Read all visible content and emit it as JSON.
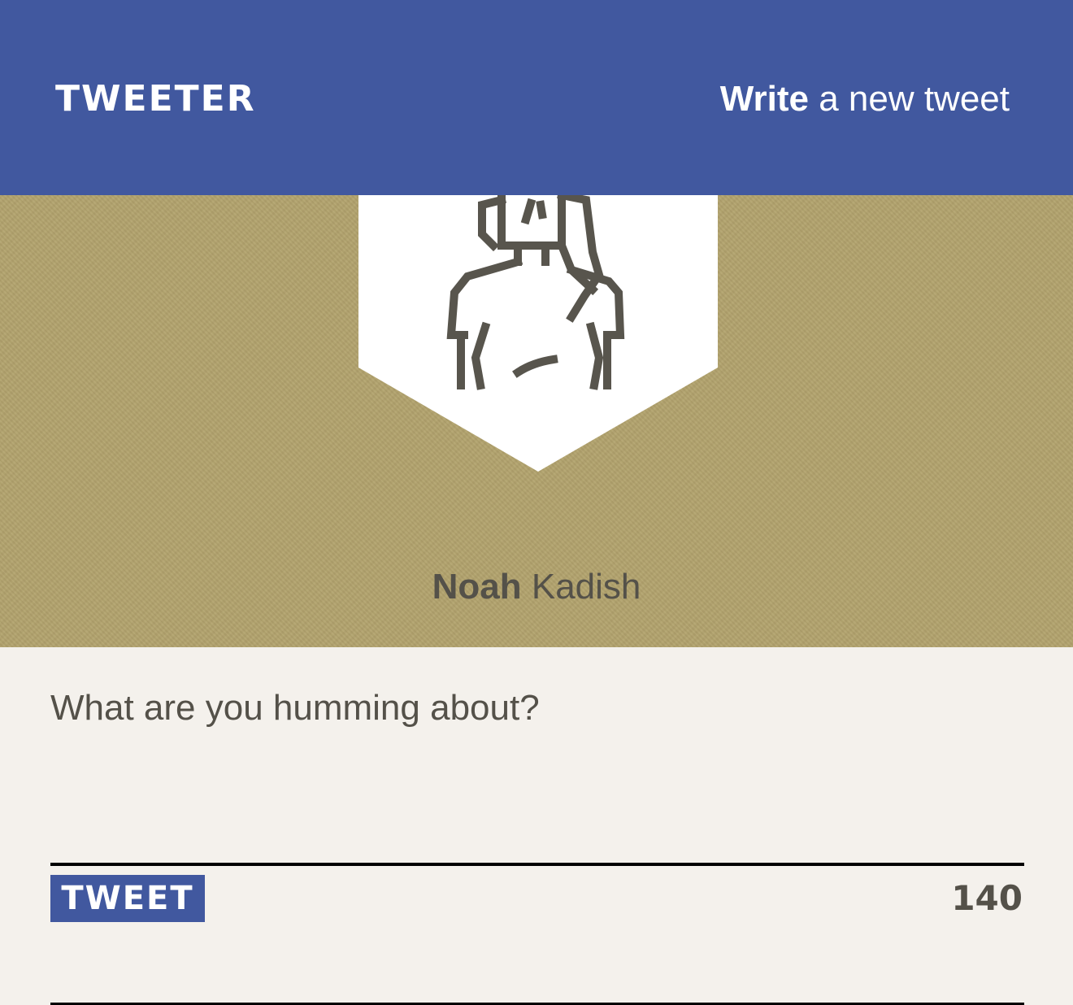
{
  "header": {
    "brand": "TWEETER",
    "compose_strong": "Write",
    "compose_rest": "a new tweet"
  },
  "profile": {
    "first_name": "Noah",
    "last_name": "Kadish",
    "avatar_icon": "person-avatar-icon"
  },
  "composer": {
    "placeholder": "What are you humming about?",
    "value": "",
    "submit_label": "TWEET",
    "chars_remaining": "140"
  },
  "colors": {
    "nav": "#41589f",
    "banner": "#b2a36d",
    "page": "#f4f1ec",
    "text": "#545149",
    "button": "#41589f"
  }
}
